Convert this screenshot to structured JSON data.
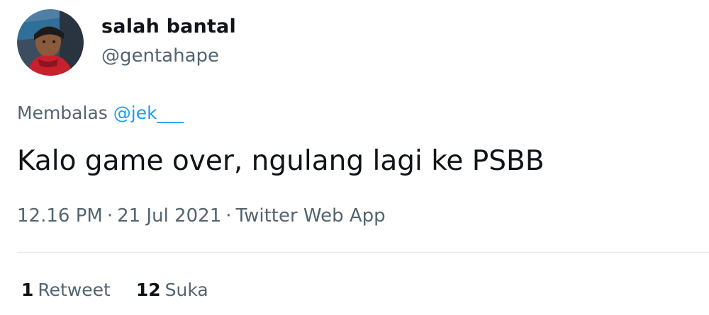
{
  "user": {
    "display_name": "salah bantal",
    "handle": "@gentahape",
    "avatar_icon": "profile-photo"
  },
  "reply": {
    "prefix": "Membalas",
    "mention": "@jek___"
  },
  "tweet": {
    "text": "Kalo game over, ngulang lagi ke PSBB",
    "time": "12.16 PM",
    "date": "21 Jul 2021",
    "source": "Twitter Web App",
    "separator": "·"
  },
  "stats": {
    "retweets_count": "1",
    "retweets_label": "Retweet",
    "likes_count": "12",
    "likes_label": "Suka"
  },
  "colors": {
    "text_primary": "#0f1419",
    "text_secondary": "#536471",
    "link": "#1d9bf0",
    "divider": "#e1e8ed"
  }
}
